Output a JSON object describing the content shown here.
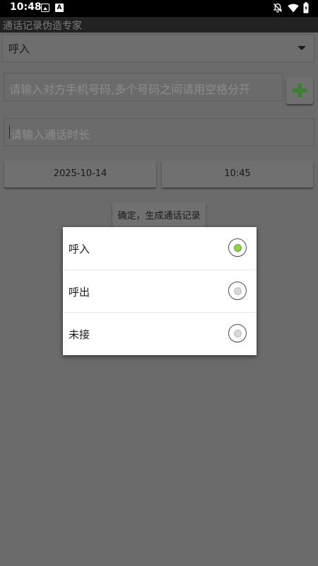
{
  "status_bar": {
    "time": "10:48",
    "icons": [
      "image-icon",
      "a-badge-icon",
      "bell-off-icon",
      "wifi-icon",
      "battery-icon"
    ],
    "a_badge": "A"
  },
  "app": {
    "title": "通话记录伪造专家"
  },
  "call_type_spinner": {
    "value": "呼入"
  },
  "phone_input": {
    "placeholder": "请输入对方手机号码,多个号码之间请用空格分开",
    "value": ""
  },
  "duration_input": {
    "placeholder": "请输入通话时长",
    "value": ""
  },
  "date_button": {
    "label": "2025-10-14"
  },
  "time_button": {
    "label": "10:45"
  },
  "generate_button": {
    "label": "确定，生成通话记录"
  },
  "dialog": {
    "options": [
      {
        "label": "呼入",
        "selected": true
      },
      {
        "label": "呼出",
        "selected": false
      },
      {
        "label": "未接",
        "selected": false
      }
    ]
  },
  "colors": {
    "accent": "#8fd14a",
    "plus_icon": "#3f7f35",
    "background": "#6b6b6b"
  }
}
